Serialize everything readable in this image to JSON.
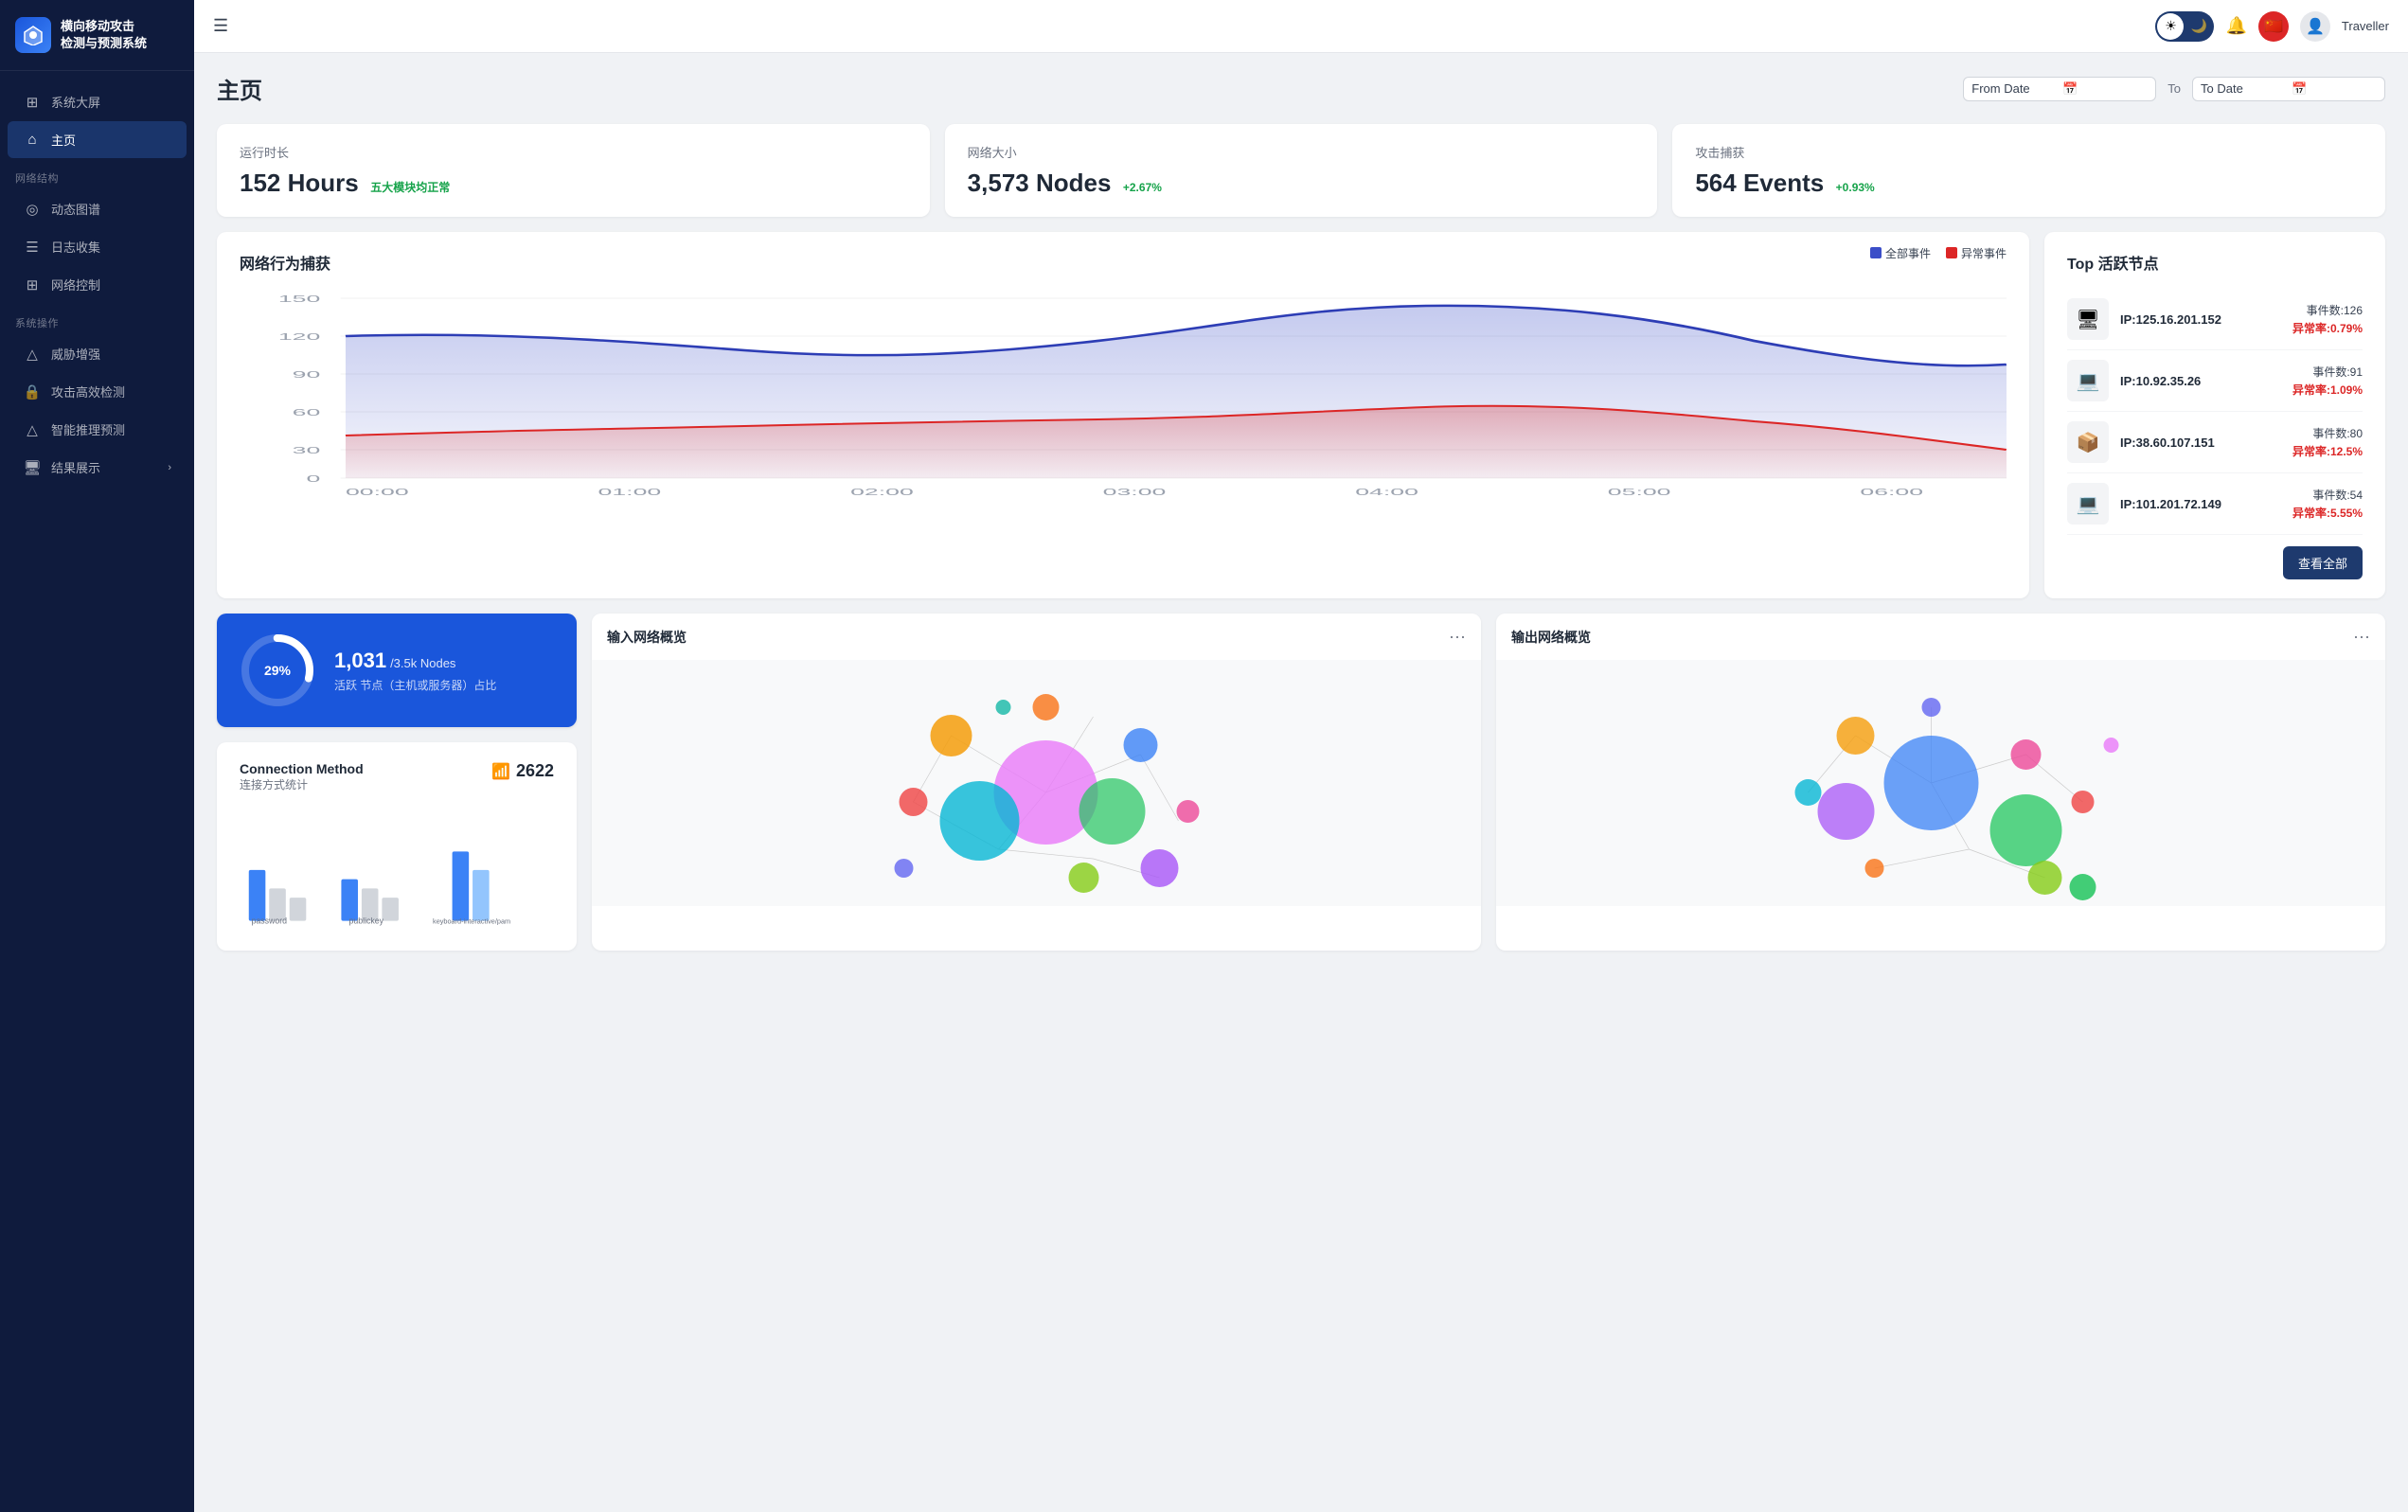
{
  "sidebar": {
    "logo_text": "横向移动攻击\n检测与预测系统",
    "nav_items": [
      {
        "id": "dashboard",
        "label": "系统大屏",
        "icon": "⊞",
        "section": null,
        "active": false
      },
      {
        "id": "home",
        "label": "主页",
        "icon": "⌂",
        "section": null,
        "active": true
      },
      {
        "id": "network_structure",
        "label": "网络结构",
        "section_label": "网络结构",
        "is_section": true
      },
      {
        "id": "dynamic_graph",
        "label": "动态图谱",
        "icon": "◎",
        "section": "network_structure",
        "active": false
      },
      {
        "id": "log_collection",
        "label": "日志收集",
        "icon": "☰",
        "section": "network_structure",
        "active": false
      },
      {
        "id": "network_control",
        "label": "网络控制",
        "icon": "⊞",
        "section": "network_structure",
        "active": false
      },
      {
        "id": "system_ops",
        "label": "系统操作",
        "section_label": "系统操作",
        "is_section": true
      },
      {
        "id": "threat_enhance",
        "label": "威胁增强",
        "icon": "△",
        "section": "system_ops",
        "active": false
      },
      {
        "id": "attack_detect",
        "label": "攻击高效检测",
        "icon": "🔒",
        "section": "system_ops",
        "active": false
      },
      {
        "id": "ai_predict",
        "label": "智能推理预测",
        "icon": "△",
        "section": "system_ops",
        "active": false
      },
      {
        "id": "results",
        "label": "结果展示",
        "icon": "🖥",
        "section": "system_ops",
        "active": false,
        "has_chevron": true
      }
    ]
  },
  "topbar": {
    "username": "Traveller",
    "theme_sun": "☀",
    "theme_moon": "🌙",
    "bell": "🔔",
    "flag": "🇨🇳",
    "hamburger": "☰"
  },
  "page": {
    "title": "主页",
    "from_date_label": "From Date",
    "to_label": "To",
    "to_date_label": "To Date"
  },
  "stats": [
    {
      "label": "运行时长",
      "value": "152 Hours",
      "badge": "五大模块均正常",
      "badge_color": "#16a34a"
    },
    {
      "label": "网络大小",
      "value": "3,573 Nodes",
      "badge": "+2.67%",
      "badge_color": "#16a34a"
    },
    {
      "label": "攻击捕获",
      "value": "564 Events",
      "badge": "+0.93%",
      "badge_color": "#16a34a"
    }
  ],
  "chart": {
    "title": "网络行为捕获",
    "legend": [
      {
        "label": "全部事件",
        "color": "#3b4ec8"
      },
      {
        "label": "异常事件",
        "color": "#dc2626"
      }
    ],
    "y_labels": [
      "150",
      "120",
      "90",
      "60",
      "30",
      "0"
    ],
    "x_labels": [
      "00:00",
      "01:00",
      "02:00",
      "03:00",
      "04:00",
      "05:00",
      "06:00"
    ]
  },
  "active_nodes": {
    "title": "Top 活跃节点",
    "view_all_label": "查看全部",
    "nodes": [
      {
        "ip": "IP:125.16.201.152",
        "events_label": "事件数:126",
        "anomaly_label": "异常率:0.79%",
        "icon": "🖥"
      },
      {
        "ip": "IP:10.92.35.26",
        "events_label": "事件数:91",
        "anomaly_label": "异常率:1.09%",
        "icon": "💻"
      },
      {
        "ip": "IP:38.60.107.151",
        "events_label": "事件数:80",
        "anomaly_label": "异常率:12.5%",
        "icon": "📦"
      },
      {
        "ip": "IP:101.201.72.149",
        "events_label": "事件数:54",
        "anomaly_label": "异常率:5.55%",
        "icon": "💻"
      }
    ]
  },
  "progress": {
    "percent": 29,
    "percent_label": "29%",
    "count": "1,031",
    "total": "/3.5k Nodes",
    "description": "活跃 节点（主机或服务器）占比"
  },
  "connection": {
    "title": "Connection Method",
    "subtitle": "连接方式统计",
    "count": "2622",
    "wifi_icon": "📶",
    "bar_groups": [
      {
        "label": "password",
        "bars": [
          {
            "height": 60,
            "type": "blue"
          },
          {
            "height": 30,
            "type": "gray"
          },
          {
            "height": 20,
            "type": "gray"
          }
        ]
      },
      {
        "label": "publickey",
        "bars": [
          {
            "height": 40,
            "type": "blue"
          },
          {
            "height": 25,
            "type": "gray"
          }
        ]
      },
      {
        "label": "keyboard-interactive/pam",
        "bars": [
          {
            "height": 80,
            "type": "blue"
          },
          {
            "height": 50,
            "type": "gray"
          }
        ]
      }
    ]
  },
  "network_in": {
    "title": "输入网络概览",
    "dots_menu": "···"
  },
  "network_out": {
    "title": "输出网络概览",
    "dots_menu": "···"
  }
}
